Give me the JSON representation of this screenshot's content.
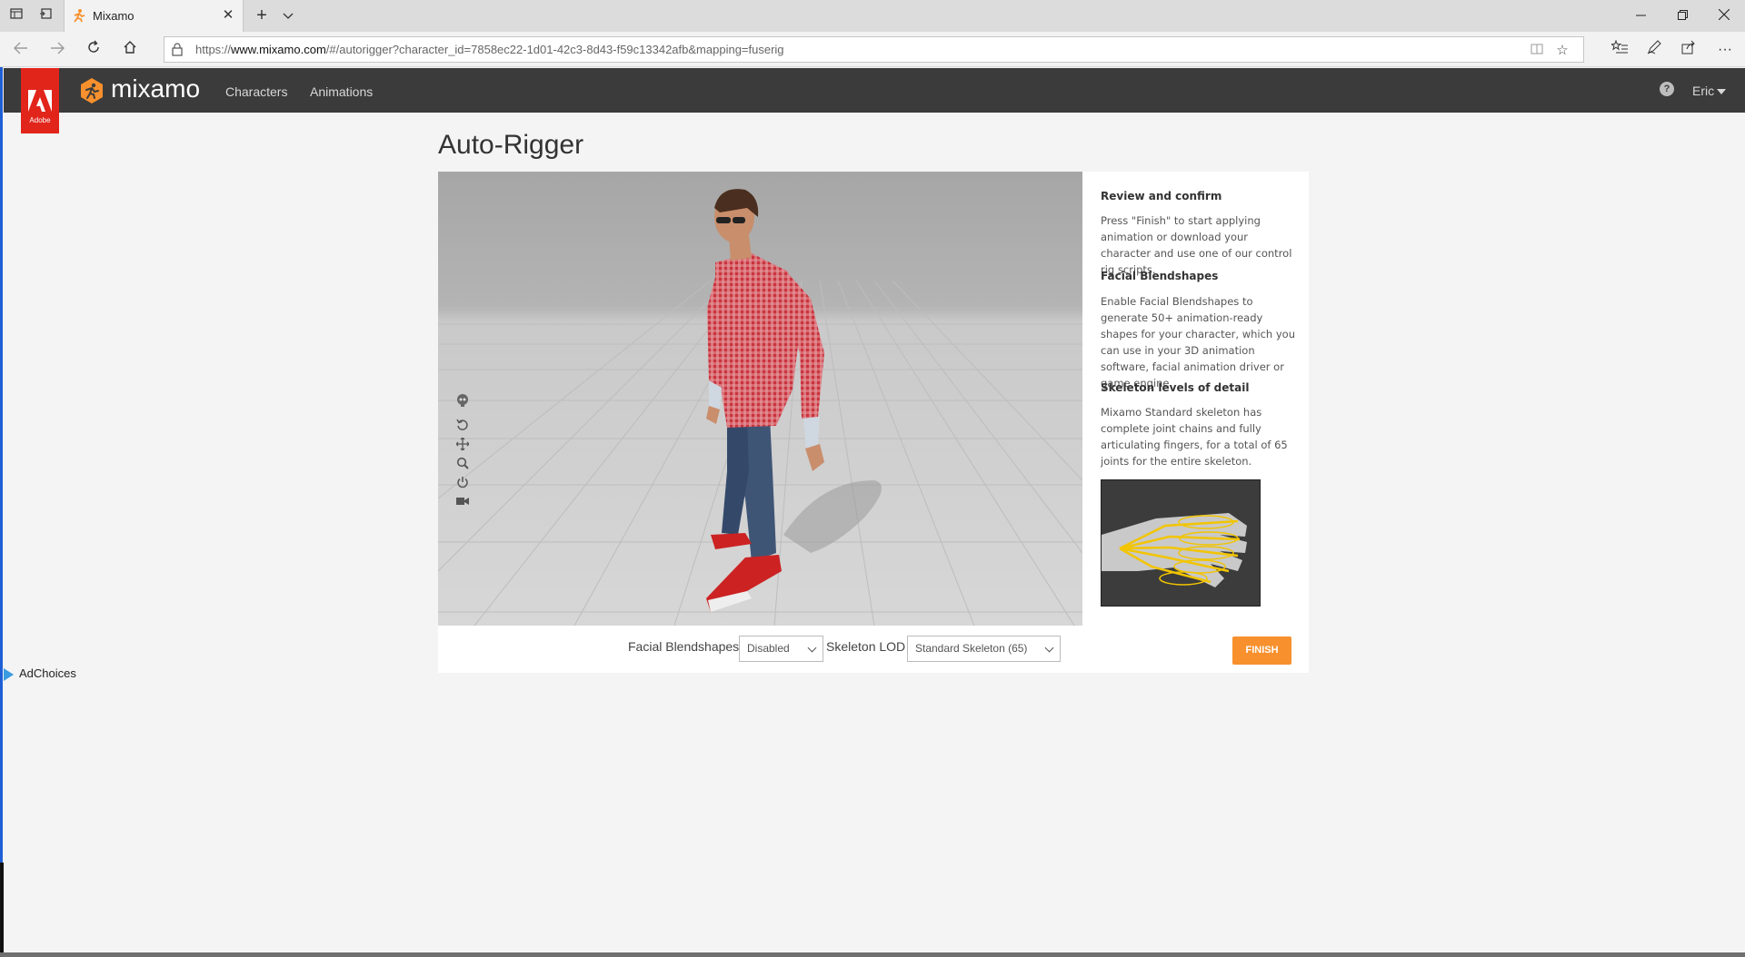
{
  "browser": {
    "tab_title": "Mixamo",
    "url_prefix": "https://",
    "url_domain": "www.mixamo.com",
    "url_path": "/#/autorigger?character_id=7858ec22-1d01-42c3-8d43-f59c13342afb&mapping=fuserig",
    "icons": [
      "tab-actions-icon",
      "set-aside-tabs-icon",
      "mixamo-favicon",
      "close-icon",
      "new-tab-icon",
      "tab-list-chevron-icon",
      "minimize-icon",
      "restore-icon",
      "window-close-icon",
      "back-icon",
      "forward-icon",
      "refresh-icon",
      "home-icon",
      "lock-icon",
      "reading-view-icon",
      "star-icon",
      "favorites-icon",
      "pen-icon",
      "share-icon",
      "more-icon"
    ]
  },
  "header": {
    "brand": "mixamo",
    "adobe_label": "Adobe",
    "nav": [
      "Characters",
      "Animations"
    ],
    "help_glyph": "?",
    "user": "Eric",
    "colors": {
      "bar": "#3b3b3b",
      "adobe_red": "#e1251b",
      "logo_orange": "#f7902d"
    }
  },
  "page": {
    "title": "Auto-Rigger"
  },
  "viewer": {
    "tool_icons": [
      "skeleton-icon",
      "reset-icon",
      "move-icon",
      "zoom-icon",
      "power-icon",
      "camera-icon"
    ]
  },
  "side_panel": {
    "sections": [
      {
        "heading": "Review and confirm",
        "body": "Press \"Finish\" to start applying animation or download your character and use one of our control rig scripts."
      },
      {
        "heading": "Facial Blendshapes",
        "body": "Enable Facial Blendshapes to generate 50+ animation-ready shapes for your character, which you can use in your 3D animation software, facial animation driver or game engine."
      },
      {
        "heading": "Skeleton levels of detail",
        "body": "Mixamo Standard skeleton has complete joint chains and fully articulating fingers, for a total of 65 joints for the entire skeleton."
      }
    ]
  },
  "controls": {
    "blendshapes_label": "Facial Blendshapes",
    "blendshapes_value": "Disabled",
    "skeleton_label": "Skeleton LOD",
    "skeleton_value": "Standard Skeleton (65)",
    "finish_label": "FINISH",
    "finish_color": "#f7902d"
  },
  "ad": {
    "label": "AdChoices"
  }
}
